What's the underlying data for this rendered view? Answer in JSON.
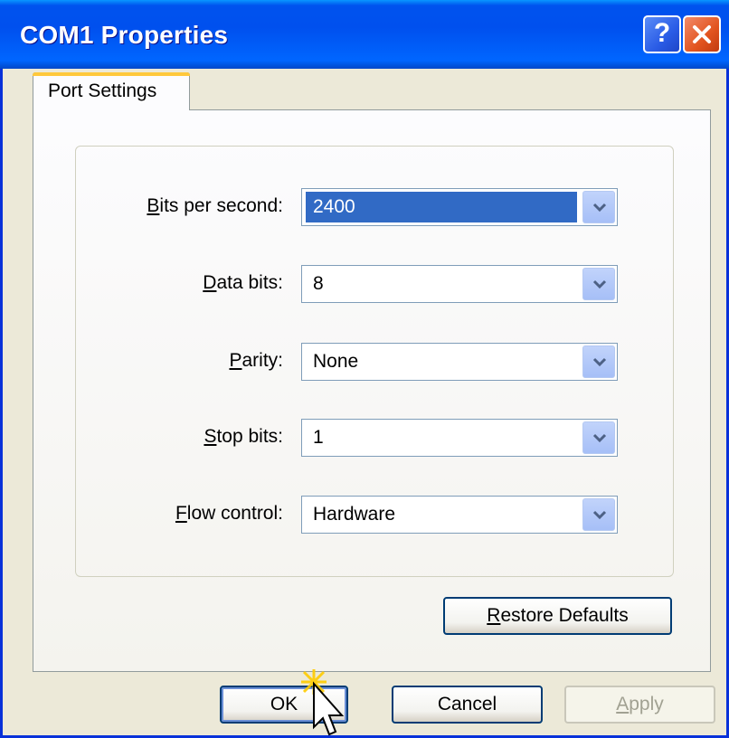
{
  "window": {
    "title": "COM1 Properties",
    "help_glyph": "?",
    "close_glyph": "✕"
  },
  "tabs": [
    {
      "label": "Port Settings",
      "active": true
    }
  ],
  "fields": [
    {
      "label_mnemonic": "B",
      "label_rest": "its per second:",
      "value": "2400",
      "focused": true
    },
    {
      "label_mnemonic": "D",
      "label_rest": "ata bits:",
      "value": "8",
      "focused": false
    },
    {
      "label_mnemonic": "P",
      "label_rest": "arity:",
      "value": "None",
      "focused": false
    },
    {
      "label_mnemonic": "S",
      "label_rest": "top bits:",
      "value": "1",
      "focused": false
    },
    {
      "label_mnemonic": "F",
      "label_rest": "low control:",
      "value": "Hardware",
      "focused": false
    }
  ],
  "buttons": {
    "restore_mnemonic": "R",
    "restore_rest": "estore Defaults",
    "ok_label": "OK",
    "cancel_label": "Cancel",
    "apply_mnemonic": "A",
    "apply_rest": "pply"
  },
  "icons": {
    "help": "help-icon",
    "close": "close-icon",
    "dropdown": "chevron-down-icon",
    "pointer": "mouse-pointer-icon"
  },
  "colors": {
    "titlebar": "#0054e3",
    "selection": "#316ac5",
    "tab_highlight": "#ffc83c",
    "close": "#e2541f"
  }
}
